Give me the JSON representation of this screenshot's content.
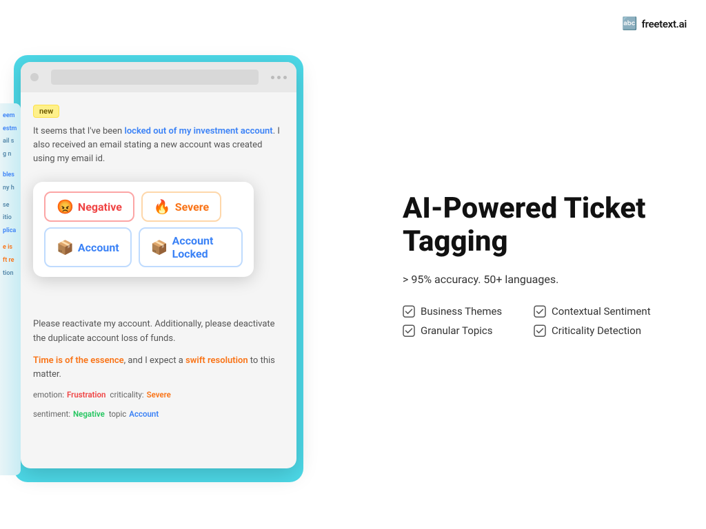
{
  "logo": {
    "icon": "🔤",
    "text": "freetext.ai"
  },
  "browser": {
    "new_badge": "new",
    "ticket_text_part1": "It seems that I've been ",
    "ticket_highlight1": "locked out of my investment account",
    "ticket_text_part2": ". I also received an email stating a new account was created using my email id.",
    "tags": [
      {
        "emoji": "😡",
        "label": "Negative",
        "type": "negative"
      },
      {
        "emoji": "🔥",
        "label": "Severe",
        "type": "severe"
      },
      {
        "emoji": "📦",
        "label": "Account",
        "type": "account"
      },
      {
        "emoji": "📦",
        "label": "Account Locked",
        "type": "account-locked"
      }
    ],
    "ticket_text2_part1": "Please reactivate my account. Additionally, please ",
    "ticket_highlight2": "deactivate the duplicate account",
    "ticket_text2_part2": "  loss of funds.",
    "ticket_text3_part1": "",
    "ticket_highlight3": "Time is of the essence",
    "ticket_text3_part2": ", and I expect a ",
    "ticket_highlight4": "swift resolution",
    "ticket_text3_part3": " to this matter.",
    "meta": [
      {
        "label": "emotion:",
        "value": "Frustration",
        "type": "frustration"
      },
      {
        "label": "criticality:",
        "value": "Severe",
        "type": "severe-val"
      },
      {
        "label": "sentiment:",
        "value": "Negative",
        "type": "negative-val"
      },
      {
        "label": "topic",
        "value": "Account",
        "type": "account-val"
      }
    ]
  },
  "right": {
    "heading_line1": "AI-Powered Ticket",
    "heading_line2": "Tagging",
    "accuracy": "> 95% accuracy. 50+ languages.",
    "features": [
      {
        "label": "Business Themes"
      },
      {
        "label": "Contextual Sentiment"
      },
      {
        "label": "Granular Topics"
      },
      {
        "label": "Criticality Detection"
      }
    ]
  }
}
